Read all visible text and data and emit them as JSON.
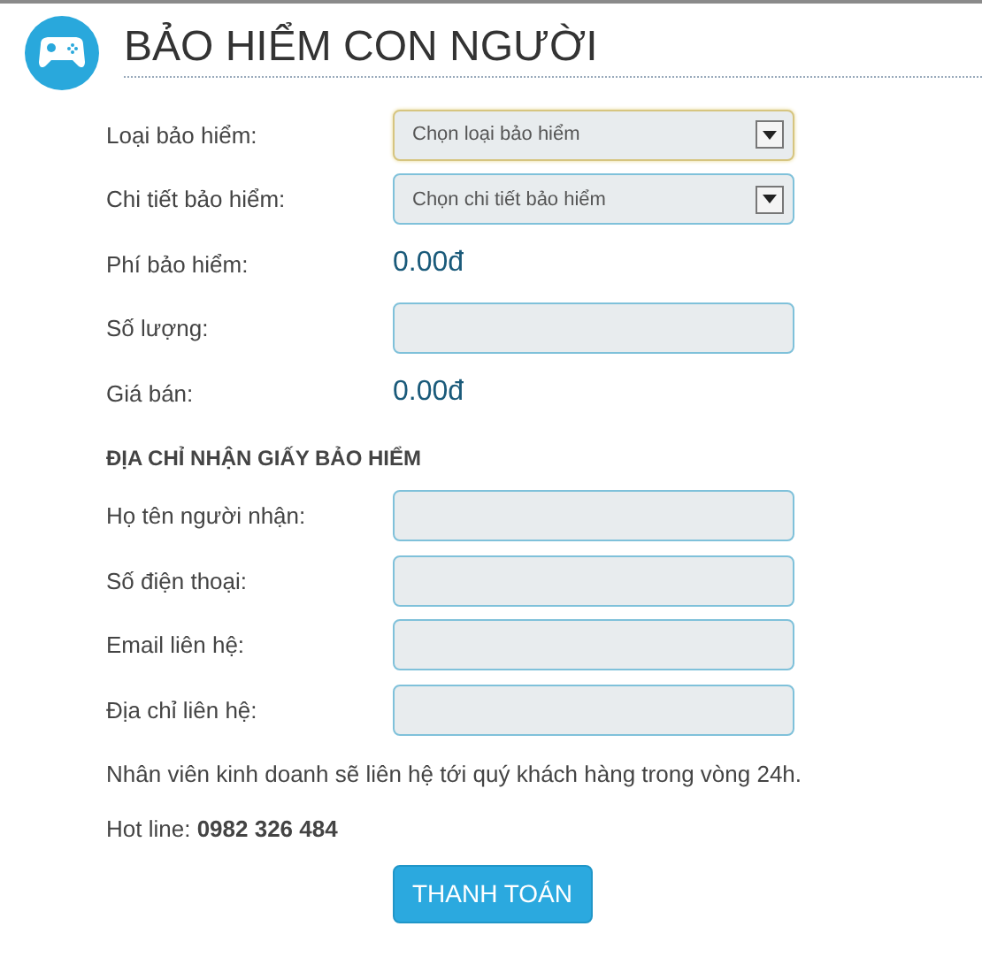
{
  "header": {
    "title": "BẢO HIỂM CON NGƯỜI"
  },
  "fields": [
    {
      "kind": "select",
      "label": "Loại bảo hiểm:",
      "placeholder": "Chọn loại bảo hiểm",
      "focused": true
    },
    {
      "kind": "select",
      "label": "Chi tiết bảo hiểm:",
      "placeholder": "Chọn chi tiết bảo hiểm",
      "focused": false
    },
    {
      "kind": "value",
      "label": "Phí bảo hiểm:",
      "value": "0.00đ"
    },
    {
      "kind": "input",
      "label": "Số lượng:",
      "focused": false
    },
    {
      "kind": "value",
      "label": "Giá bán:",
      "value": "0.00đ"
    }
  ],
  "address_section": {
    "heading": "ĐỊA CHỈ NHẬN GIẤY BẢO HIỂM",
    "fields": [
      {
        "kind": "input",
        "label": "Họ tên người nhận:",
        "focused": false
      },
      {
        "kind": "input",
        "label": "Số điện thoại:",
        "focused": false
      },
      {
        "kind": "input",
        "label": "Email liên hệ:",
        "focused": false
      },
      {
        "kind": "input",
        "label": "Địa chỉ liên hệ:",
        "focused": false
      }
    ]
  },
  "note": "Nhân viên kinh doanh sẽ liên hệ tới quý khách hàng trong vòng 24h.",
  "hotline": "Hot line: **0982 326 484**",
  "submit_button": "THANH TOÁN"
}
